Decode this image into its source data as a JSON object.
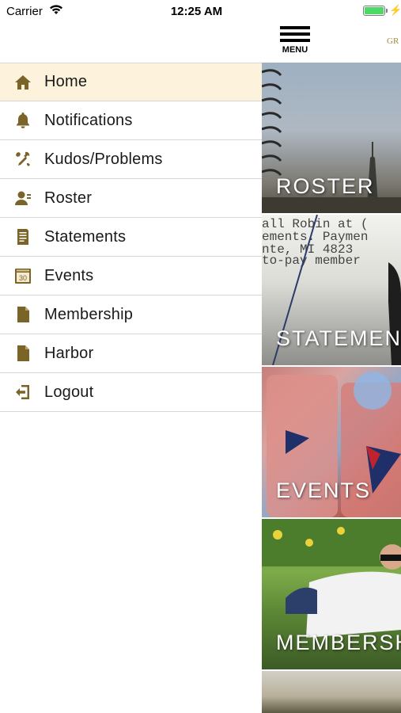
{
  "status_bar": {
    "carrier": "Carrier",
    "time": "12:25 AM",
    "battery_level": 1.0
  },
  "drawer": {
    "items": [
      {
        "label": "Home",
        "icon": "home-icon",
        "active": true
      },
      {
        "label": "Notifications",
        "icon": "bell-icon",
        "active": false
      },
      {
        "label": "Kudos/Problems",
        "icon": "tools-icon",
        "active": false
      },
      {
        "label": "Roster",
        "icon": "person-icon",
        "active": false
      },
      {
        "label": "Statements",
        "icon": "document-lines-icon",
        "active": false
      },
      {
        "label": "Events",
        "icon": "calendar-icon",
        "active": false
      },
      {
        "label": "Membership",
        "icon": "file-icon",
        "active": false
      },
      {
        "label": "Harbor",
        "icon": "file-icon",
        "active": false
      },
      {
        "label": "Logout",
        "icon": "logout-icon",
        "active": false
      }
    ]
  },
  "main": {
    "menu_label": "MENU",
    "brand_text": "GR",
    "tiles": [
      {
        "label": "ROSTER"
      },
      {
        "label": "STATEMENTS"
      },
      {
        "label": "EVENTS"
      },
      {
        "label": "MEMBERSHIP"
      },
      {
        "label": ""
      }
    ]
  },
  "colors": {
    "icon": "#7a6428",
    "active_bg": "#fdf3dc",
    "divider": "#d6d6d6",
    "brand": "#a58a3a"
  }
}
